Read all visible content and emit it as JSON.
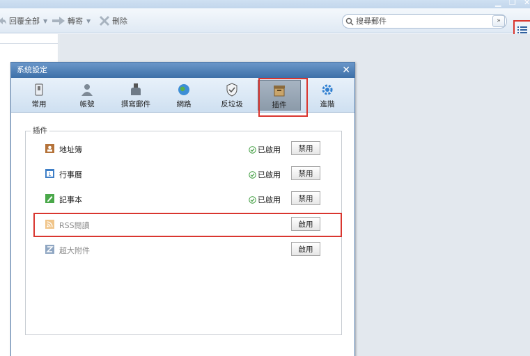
{
  "toolbar": {
    "reply_all": "回覆全部",
    "forward": "轉寄",
    "delete": "刪除",
    "search_placeholder": "搜尋郵件"
  },
  "dialog": {
    "title": "系統設定",
    "tabs": [
      {
        "label": "常用",
        "icon": "general-icon"
      },
      {
        "label": "帳號",
        "icon": "account-icon"
      },
      {
        "label": "撰寫郵件",
        "icon": "compose-icon"
      },
      {
        "label": "網路",
        "icon": "network-icon"
      },
      {
        "label": "反垃圾",
        "icon": "antispam-icon"
      },
      {
        "label": "插件",
        "icon": "plugin-icon",
        "active": true
      },
      {
        "label": "進階",
        "icon": "advanced-icon"
      }
    ],
    "group_label": "插件",
    "plugins": [
      {
        "name": "地址簿",
        "status": "已啟用",
        "button": "禁用",
        "enabled": true
      },
      {
        "name": "行事曆",
        "status": "已啟用",
        "button": "禁用",
        "enabled": true
      },
      {
        "name": "記事本",
        "status": "已啟用",
        "button": "禁用",
        "enabled": true
      },
      {
        "name": "RSS閱讀",
        "status": "",
        "button": "啟用",
        "enabled": false
      },
      {
        "name": "超大附件",
        "status": "",
        "button": "啟用",
        "enabled": false
      }
    ]
  },
  "colors": {
    "highlight": "#d9362f",
    "dialog_title": "#3d6fa8",
    "status_ok": "#3a9a3a"
  }
}
